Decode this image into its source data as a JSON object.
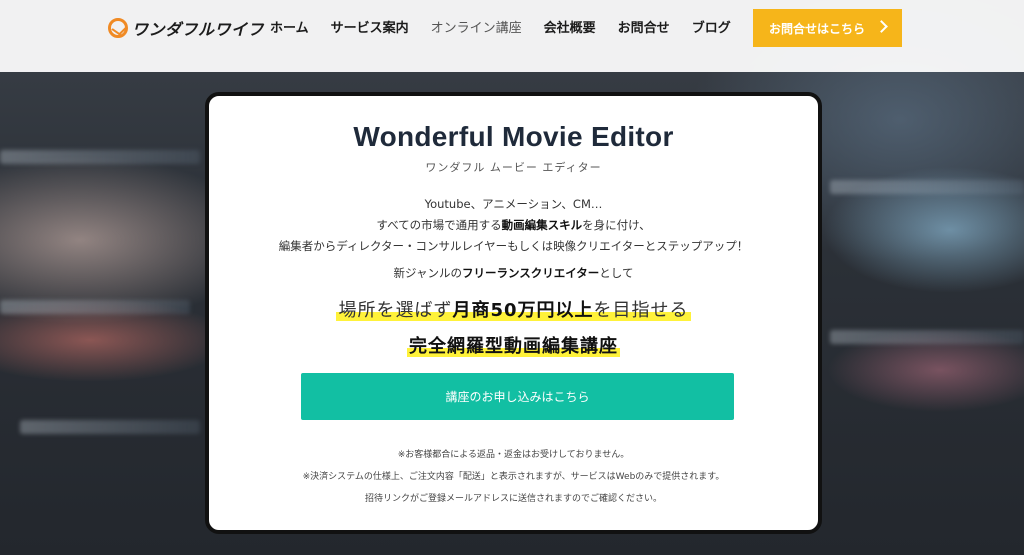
{
  "header": {
    "logo_text": "ワンダフルワイフ",
    "nav": [
      {
        "label": "ホーム"
      },
      {
        "label": "サービス案内"
      },
      {
        "label": "オンライン講座"
      },
      {
        "label": "会社概要"
      },
      {
        "label": "お問合せ"
      },
      {
        "label": "ブログ"
      }
    ],
    "cta_label": "お問合せはこちら"
  },
  "card": {
    "title": "Wonderful Movie Editor",
    "subtitle": "ワンダフル ムービー エディター",
    "desc_line1": "Youtube、アニメーション、CM…",
    "desc_line2_pre": "すべての市場で通用する",
    "desc_line2_bold": "動画編集スキル",
    "desc_line2_post": "を身に付け、",
    "desc_line3": "編集者からディレクター・コンサルレイヤーもしくは映像クリエイターとステップアップ！",
    "lead_pre": "新ジャンルの",
    "lead_bold": "フリーランスクリエイター",
    "lead_post": "として",
    "big1_pre": "場所を選ばず",
    "big1_bold": "月商50万円以上",
    "big1_post": "を目指せる",
    "big2": "完全網羅型動画編集講座",
    "apply_label": "講座のお申し込みはこちら",
    "notes": [
      "※お客様都合による返品・返金はお受けしておりません。",
      "※決済システムの仕様上、ご注文内容「配送」と表示されますが、サービスはWebのみで提供されます。",
      "招待リンクがご登録メールアドレスに送信されますのでご確認ください。"
    ]
  },
  "colors": {
    "accent_orange": "#f6b51a",
    "apply_green": "#12bfa3",
    "highlight_yellow": "#fff23a",
    "logo_orange": "#f08a24"
  },
  "icons": {
    "logo": "circle-check-icon",
    "cta_arrow": "chevron-right-icon"
  }
}
